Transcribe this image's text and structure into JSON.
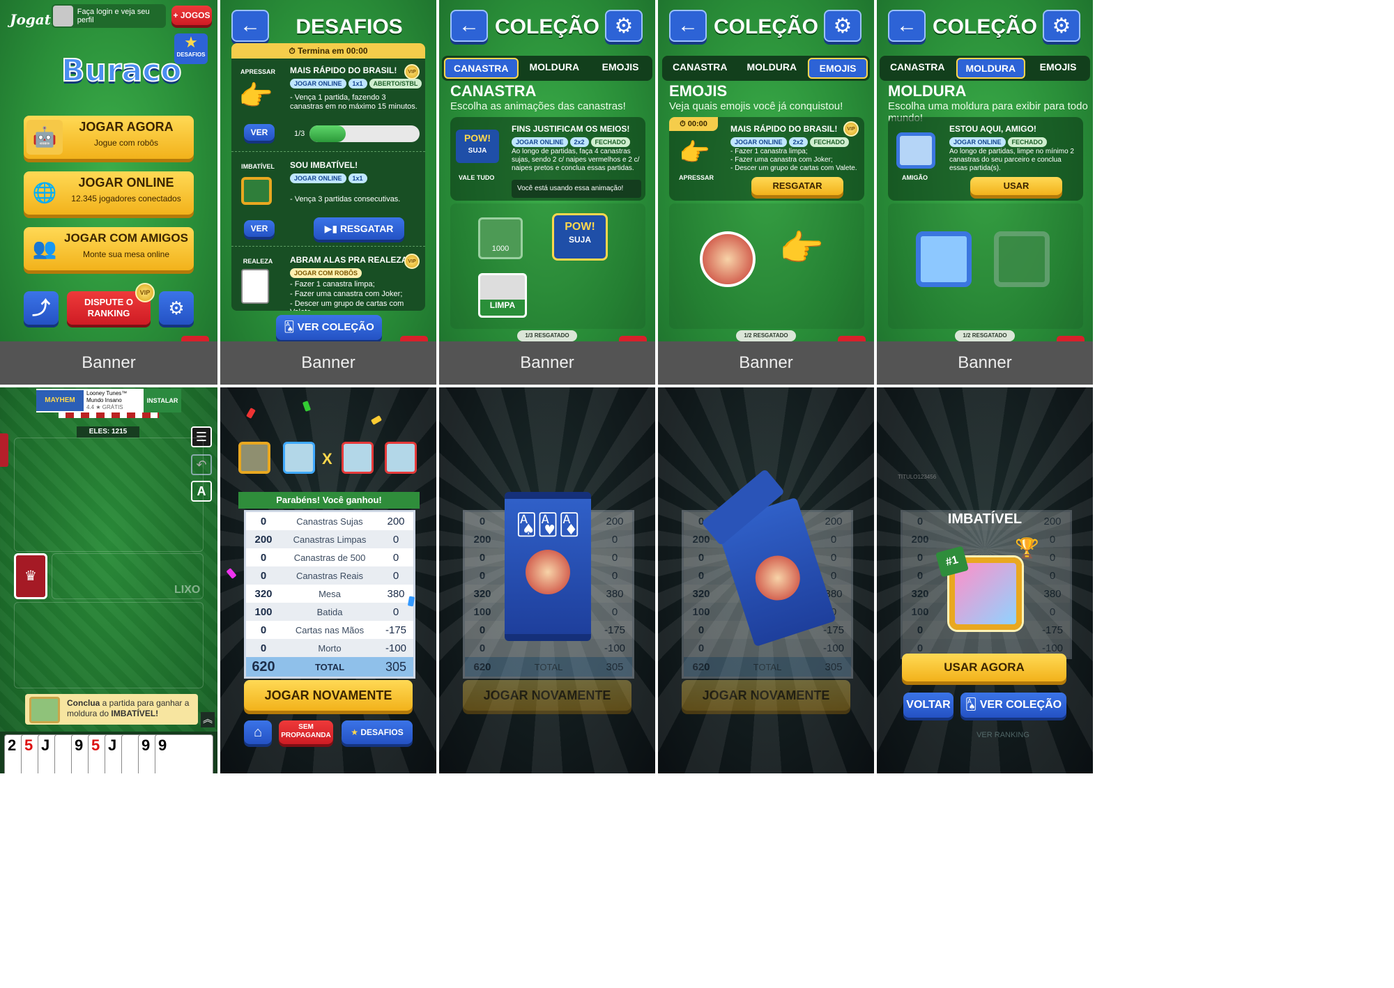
{
  "p1": {
    "logo": "Jogatina",
    "login_text": "Faça login e veja seu perfil",
    "jogos_btn": "+ JOGOS",
    "desafios_label": "DESAFIOS",
    "game_title": "Buraco",
    "btn1_title": "JOGAR AGORA",
    "btn1_sub": "Jogue com robôs",
    "btn2_title": "JOGAR ONLINE",
    "btn2_sub": "12.345 jogadores conectados",
    "btn3_title": "JOGAR COM AMIGOS",
    "btn3_sub": "Monte sua mesa online",
    "ranking_btn": "DISPUTE O RANKING",
    "vip": "VIP",
    "banner": "Banner"
  },
  "p2": {
    "title": "DESAFIOS",
    "timer": "Termina em 00:00",
    "c1_tag": "APRESSAR",
    "c1_title": "MAIS RÁPIDO DO BRASIL!",
    "c1_pills": [
      "JOGAR ONLINE",
      "1x1",
      "ABERTO/STBL"
    ],
    "c1_desc": "- Vença 1 partida, fazendo 3 canastras em no máximo 15 minutos.",
    "c1_progress": "1/3",
    "c1_progress_value": 0.33,
    "c1_btn": "VER",
    "c2_tag": "IMBATÍVEL",
    "c2_title": "SOU IMBATÍVEL!",
    "c2_pills": [
      "JOGAR ONLINE",
      "1x1"
    ],
    "c2_desc": "- Vença 3 partidas consecutivas.",
    "c2_btn": "VER",
    "c2_resgatar": "RESGATAR",
    "c3_tag": "REALEZA",
    "c3_title": "ABRAM ALAS PRA REALEZA!",
    "c3_pills": [
      "JOGAR COM ROBÔS"
    ],
    "c3_desc1": "- Fazer 1 canastra limpa;",
    "c3_desc2": "- Fazer uma canastra com Joker;",
    "c3_desc3": "- Descer um grupo de cartas com Valete.",
    "ver_colecao": "VER COLEÇÃO",
    "banner": "Banner"
  },
  "p3": {
    "title": "COLEÇÃO",
    "tabs": [
      "CANASTRA",
      "MOLDURA",
      "EMOJIS"
    ],
    "section": "CANASTRA",
    "section_sub": "Escolha as animações das canastras!",
    "item_title": "FINS JUSTIFICAM OS MEIOS!",
    "item_pills": [
      "JOGAR ONLINE",
      "2x2",
      "FECHADO"
    ],
    "item_desc": "Ao longo de partidas, faça 4 canastras sujas, sendo 2 c/ naipes vermelhos e 2 c/ naipes pretos e conclua essas partidas.",
    "item_tag": "VALE TUDO",
    "item_status": "Você está usando essa animação!",
    "pow_text": "POW!",
    "suja_text": "SUJA",
    "limpa_text": "LIMPA",
    "mil_text": "1000",
    "counter": "1/3 RESGATADO",
    "banner": "Banner"
  },
  "p4": {
    "title": "COLEÇÃO",
    "tabs": [
      "CANASTRA",
      "MOLDURA",
      "EMOJIS"
    ],
    "section": "EMOJIS",
    "section_sub": "Veja quais emojis você já conquistou!",
    "timer": "00:00",
    "item_title": "MAIS RÁPIDO DO BRASIL!",
    "item_pills": [
      "JOGAR ONLINE",
      "2x2",
      "FECHADO"
    ],
    "item_desc1": "- Fazer 1 canastra limpa;",
    "item_desc2": "- Fazer uma canastra com Joker;",
    "item_desc3": "- Descer um grupo de cartas com Valete.",
    "item_tag": "APRESSAR",
    "resgatar": "RESGATAR",
    "counter": "1/2 RESGATADO",
    "banner": "Banner"
  },
  "p5": {
    "title": "COLEÇÃO",
    "tabs": [
      "CANASTRA",
      "MOLDURA",
      "EMOJIS"
    ],
    "section": "MOLDURA",
    "section_sub": "Escolha uma moldura para exibir para todo mundo!",
    "item_title": "ESTOU AQUI, AMIGO!",
    "item_pills": [
      "JOGAR ONLINE",
      "FECHADO"
    ],
    "item_desc": "Ao longo de partidas, limpe no mínimo 2 canastras do seu parceiro e conclua essas partida(s).",
    "item_tag": "AMIGÃO",
    "usar": "USAR",
    "counter": "1/2 RESGATADO",
    "banner": "Banner"
  },
  "p6": {
    "ad_title": "Looney Tunes™ Mundo Insano",
    "ad_rating": "4.4 ★ GRÁTIS",
    "ad_btn": "INSTALAR",
    "ad_game": "MAYHEM",
    "score": "ELES: 1215",
    "lixo": "LIXO",
    "toast_pre": "Conclua",
    "toast_mid": " a partida para ganhar a moldura do ",
    "toast_bold": "IMBATÍVEL!",
    "a_btn": "A",
    "hand": [
      "2",
      "5",
      "J",
      "JOKER",
      "9",
      "5",
      "J",
      "JOKER",
      "9",
      "9"
    ]
  },
  "score": {
    "congrats": "Parabéns! Você ganhou!",
    "rows": [
      {
        "a": "0",
        "label": "Canastras Sujas",
        "b": "200"
      },
      {
        "a": "200",
        "label": "Canastras Limpas",
        "b": "0"
      },
      {
        "a": "0",
        "label": "Canastras de 500",
        "b": "0"
      },
      {
        "a": "0",
        "label": "Canastras Reais",
        "b": "0"
      },
      {
        "a": "320",
        "label": "Mesa",
        "b": "380"
      },
      {
        "a": "100",
        "label": "Batida",
        "b": "0"
      },
      {
        "a": "0",
        "label": "Cartas nas Mãos",
        "b": "-175"
      },
      {
        "a": "0",
        "label": "Morto",
        "b": "-100"
      }
    ],
    "total_a": "620",
    "total_label": "TOTAL",
    "total_b": "305",
    "play_again": "JOGAR NOVAMENTE",
    "sem_prop": "SEM PROPAGANDA",
    "desafios": "DESAFIOS",
    "vs": "X"
  },
  "p10": {
    "popup_title": "IMBATÍVEL",
    "rank": "#1",
    "usar_agora": "USAR AGORA",
    "voltar": "VOLTAR",
    "ver_colecao": "VER COLEÇÃO",
    "ver_ranking": "VER RANKING",
    "titulo": "TÍTULO123456"
  },
  "colors": {
    "green": "#2a8f39",
    "blue": "#2d63d6",
    "yellow": "#f7c531",
    "red": "#d9202b"
  }
}
